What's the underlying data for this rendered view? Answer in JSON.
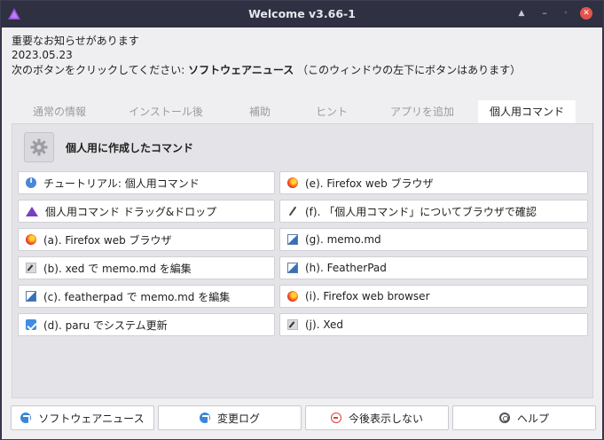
{
  "window": {
    "title": "Welcome v3.66-1"
  },
  "notice": {
    "line1": "重要なお知らせがあります",
    "date": "2023.05.23",
    "line3_prefix": "次のボタンをクリックしてください: ",
    "line3_bold": "ソフトウェアニュース",
    "line3_suffix": " （このウィンドウの左下にボタンはあります）"
  },
  "tabs": [
    {
      "label": "通常の情報"
    },
    {
      "label": "インストール後"
    },
    {
      "label": "補助"
    },
    {
      "label": "ヒント"
    },
    {
      "label": "アプリを追加"
    },
    {
      "label": "個人用コマンド"
    }
  ],
  "panel": {
    "title": "個人用に作成したコマンド"
  },
  "commands_left": [
    {
      "label": "チュートリアル: 個人用コマンド",
      "icon": "info-icon"
    },
    {
      "label": "個人用コマンド ドラッグ&ドロップ",
      "icon": "eos-triangle-icon"
    },
    {
      "label": "(a). Firefox web ブラウザ",
      "icon": "firefox-icon"
    },
    {
      "label": "(b). xed で memo.md を編集",
      "icon": "xed-icon"
    },
    {
      "label": "(c). featherpad で memo.md を編集",
      "icon": "featherpad-icon"
    },
    {
      "label": "(d). paru でシステム更新",
      "icon": "update-icon"
    }
  ],
  "commands_right": [
    {
      "label": "(e). Firefox web ブラウザ",
      "icon": "firefox-icon"
    },
    {
      "label": "(f). 「個人用コマンド」についてブラウザで確認",
      "icon": "quill-icon"
    },
    {
      "label": "(g). memo.md",
      "icon": "featherpad-icon"
    },
    {
      "label": "(h). FeatherPad",
      "icon": "featherpad-icon"
    },
    {
      "label": "(i). Firefox web browser",
      "icon": "firefox-icon"
    },
    {
      "label": "(j). Xed",
      "icon": "xed-icon"
    }
  ],
  "bottom_buttons": [
    {
      "label": "ソフトウェアニュース",
      "icon": "external-link-icon"
    },
    {
      "label": "変更ログ",
      "icon": "external-link-icon"
    },
    {
      "label": "今後表示しない",
      "icon": "no-entry-icon"
    },
    {
      "label": "ヘルプ",
      "icon": "lifebuoy-icon"
    }
  ],
  "colors": {
    "titlebar": "#2f3042",
    "close_button": "#e5534b",
    "accent_purple": "#7a3fc0",
    "info_blue": "#4a86d8"
  }
}
